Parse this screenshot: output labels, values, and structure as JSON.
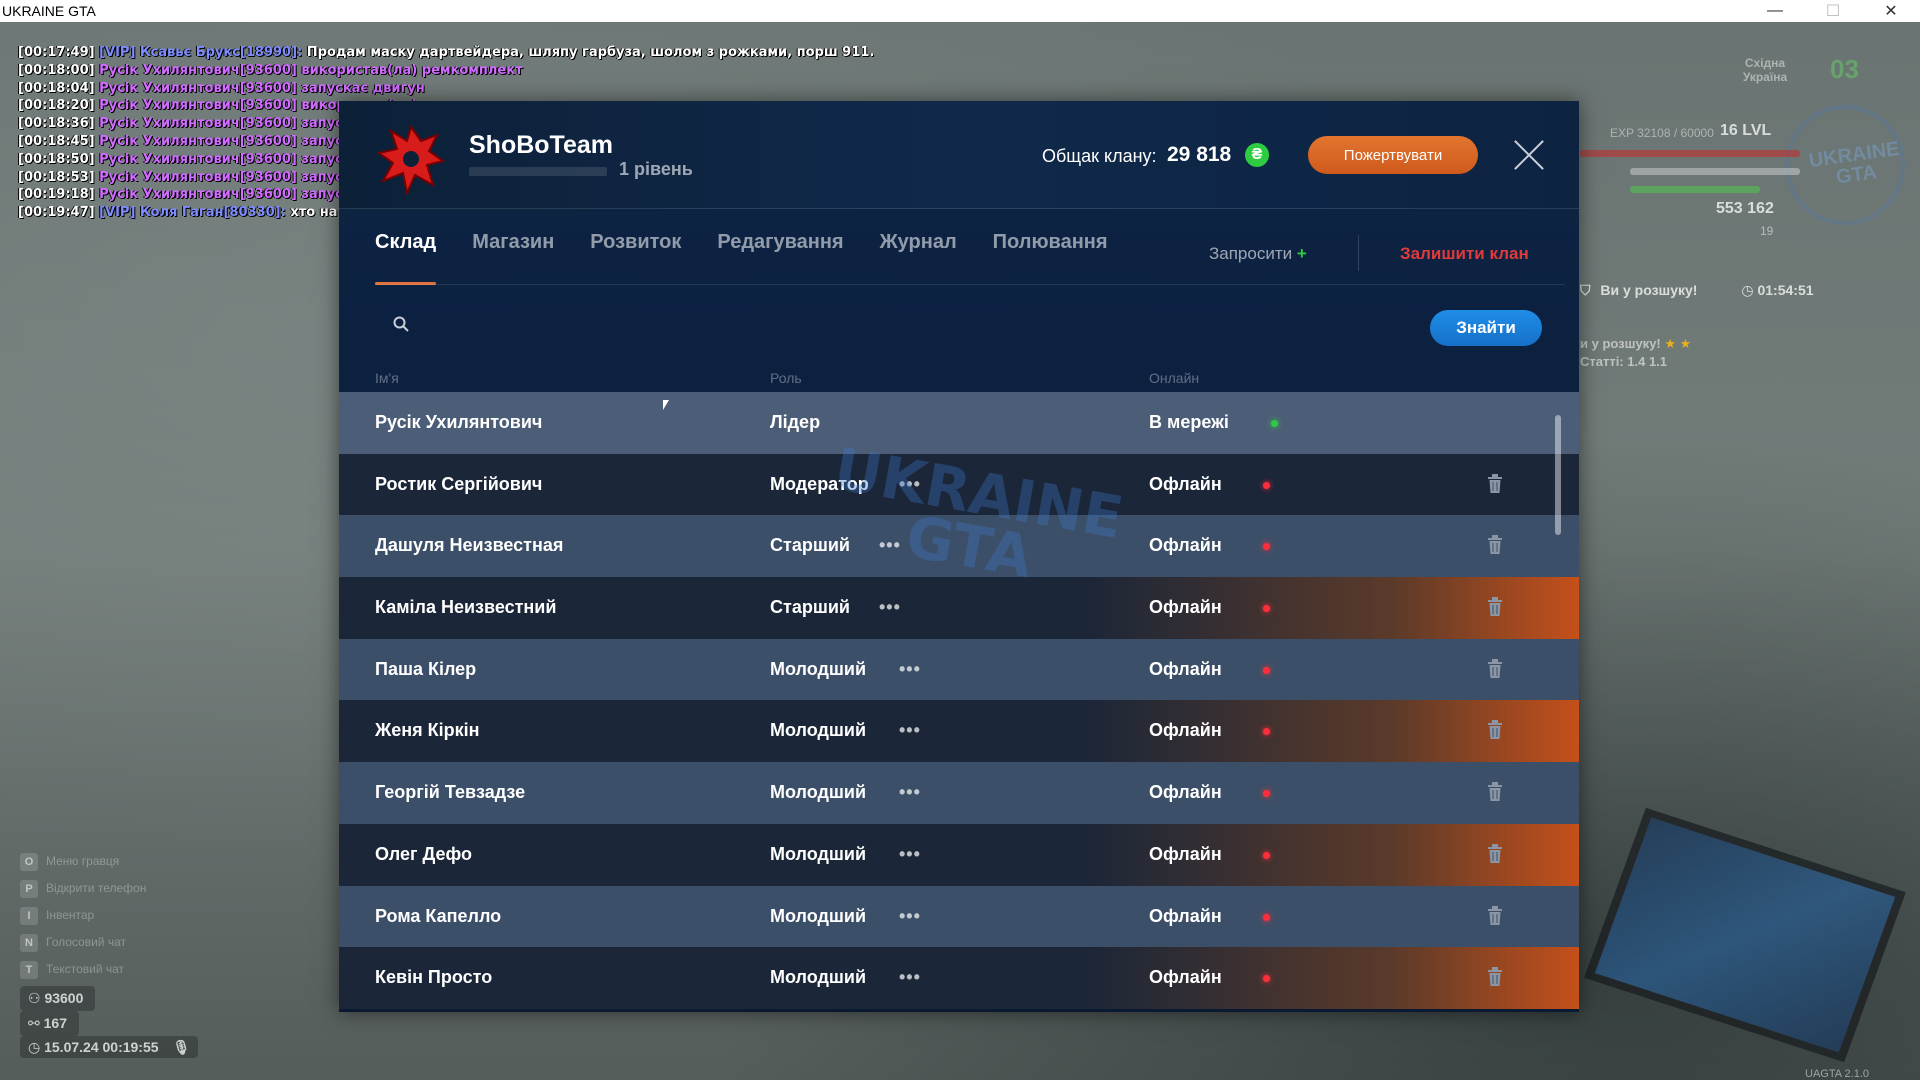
{
  "window": {
    "title": "UKRAINE GTA",
    "minimize": "—",
    "maximize": "☐",
    "close": "✕"
  },
  "chat": [
    {
      "time": "[00:17:49]",
      "name": "[VIP] Ксавьє Брукс[18990]:",
      "name_style": "vip",
      "msg": "Продам маску дартвейдера, шляпу гарбуза, шолом з рожками, порш 911.",
      "msg_style": "white"
    },
    {
      "time": "[00:18:00]",
      "name": "Русік Ухилянтович[93600]",
      "name_style": "purple",
      "msg": "використав(ла) ремкомплект",
      "msg_style": "purple"
    },
    {
      "time": "[00:18:04]",
      "name": "Русік Ухилянтович[93600]",
      "name_style": "purple",
      "msg": "запускає двигун",
      "msg_style": "purple"
    },
    {
      "time": "[00:18:20]",
      "name": "Русік Ухилянтович[93600]",
      "name_style": "purple",
      "msg": "використав(ла) ремкомплект",
      "msg_style": "purple"
    },
    {
      "time": "[00:18:36]",
      "name": "Русік Ухилянтович[93600]",
      "name_style": "purple",
      "msg": "запускає двигун",
      "msg_style": "purple"
    },
    {
      "time": "[00:18:45]",
      "name": "Русік Ухилянтович[93600]",
      "name_style": "purple",
      "msg": "запускає двигун",
      "msg_style": "purple"
    },
    {
      "time": "[00:18:50]",
      "name": "Русік Ухилянтович[93600]",
      "name_style": "purple",
      "msg": "запускає двигун",
      "msg_style": "purple"
    },
    {
      "time": "[00:18:53]",
      "name": "Русік Ухилянтович[93600]",
      "name_style": "purple",
      "msg": "запускає двигун",
      "msg_style": "purple"
    },
    {
      "time": "[00:19:18]",
      "name": "Русік Ухилянтович[93600]",
      "name_style": "purple",
      "msg": "запускає двигун",
      "msg_style": "purple"
    },
    {
      "time": "[00:19:47]",
      "name": "[VIP] Коля Гаган[80330]:",
      "name_style": "vip",
      "msg": "хто на вч",
      "msg_style": "white"
    }
  ],
  "hud": {
    "region": "Східна Україна",
    "day": "03",
    "exp": "EXP 32108 / 60000",
    "level": "16 LVL",
    "money": "553 162",
    "coins": "19",
    "logo": "UKRAINE GTA",
    "wanted_label": "Ви у розшуку!",
    "wanted_timer": "01:54:51",
    "wanted2": "и у розшуку!",
    "articles": "Статті: 1.4  1.1"
  },
  "bottom_left": {
    "hints": [
      {
        "key": "O",
        "label": "Меню гравця"
      },
      {
        "key": "P",
        "label": "Відкрити телефон"
      },
      {
        "key": "I",
        "label": "Інвентар"
      },
      {
        "key": "N",
        "label": "Голосовий чат"
      },
      {
        "key": "T",
        "label": "Текстовий чат"
      }
    ],
    "id": "93600",
    "online": "167",
    "datetime": "15.07.24 00:19:55"
  },
  "bottom_right_text": "UAGTA 2.1.0",
  "clan": {
    "name": "ShoBoTeam",
    "level": "1 рівень",
    "balance_label": "Общак клану:",
    "balance_value": "29 818",
    "currency_icon": "₴",
    "donate_label": "Пожертвувати",
    "tabs": [
      {
        "label": "Склад",
        "active": true
      },
      {
        "label": "Магазин",
        "active": false
      },
      {
        "label": "Розвиток",
        "active": false
      },
      {
        "label": "Редагування",
        "active": false
      },
      {
        "label": "Журнал",
        "active": false
      },
      {
        "label": "Полювання",
        "active": false
      }
    ],
    "invite_label": "Запросити",
    "invite_plus": "+",
    "leave_label": "Залишити клан",
    "search": {
      "placeholder": "",
      "value": "",
      "button": "Знайти"
    },
    "columns": {
      "name": "Ім'я",
      "role": "Роль",
      "status": "Онлайн"
    },
    "members": [
      {
        "name": "Русік Ухилянтович",
        "role": "Лідер",
        "status": "В мережі",
        "online": true,
        "can_edit": false
      },
      {
        "name": "Ростик Сергійович",
        "role": "Модератор",
        "status": "Офлайн",
        "online": false,
        "can_edit": true
      },
      {
        "name": "Дашуля Неизвестная",
        "role": "Старший",
        "status": "Офлайн",
        "online": false,
        "can_edit": true
      },
      {
        "name": "Каміла Неизвестний",
        "role": "Старший",
        "status": "Офлайн",
        "online": false,
        "can_edit": true
      },
      {
        "name": "Паша Кілер",
        "role": "Молодший",
        "status": "Офлайн",
        "online": false,
        "can_edit": true
      },
      {
        "name": "Женя Кіркін",
        "role": "Молодший",
        "status": "Офлайн",
        "online": false,
        "can_edit": true
      },
      {
        "name": "Георгій Тевзадзе",
        "role": "Молодший",
        "status": "Офлайн",
        "online": false,
        "can_edit": true
      },
      {
        "name": "Олег Дефо",
        "role": "Молодший",
        "status": "Офлайн",
        "online": false,
        "can_edit": true
      },
      {
        "name": "Рома Капелло",
        "role": "Молодший",
        "status": "Офлайн",
        "online": false,
        "can_edit": true
      },
      {
        "name": "Кевін Просто",
        "role": "Молодший",
        "status": "Офлайн",
        "online": false,
        "can_edit": true
      }
    ],
    "row_menu": "•••",
    "watermark": "UKRAINE GTA"
  }
}
